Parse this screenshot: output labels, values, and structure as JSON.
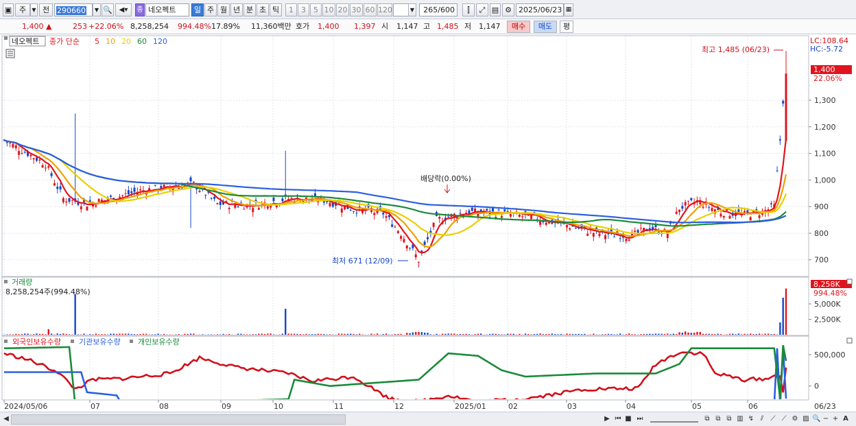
{
  "toolbar": {
    "market": "주",
    "prev": "전",
    "code": "290660",
    "name": "네오펙트",
    "name_tag": "종",
    "periods": [
      "일",
      "주",
      "월",
      "년",
      "분",
      "초",
      "틱"
    ],
    "active_period": "일",
    "ticks": [
      "1",
      "3",
      "5",
      "10",
      "20",
      "30",
      "60",
      "120"
    ],
    "count": "265",
    "count_max": "/600",
    "date": "2025/06/23"
  },
  "quote": {
    "price": "1,400",
    "change_arrow": "▲",
    "change": "253",
    "change_pct": "+22.06%",
    "volume": "8,258,254",
    "vol_ratio": "994.48%",
    "turnover": "17.89%",
    "amount": "11,360백만",
    "hoga_label": "호가",
    "ask": "1,400",
    "bid": "1,397",
    "open_label": "시",
    "open": "1,147",
    "high_label": "고",
    "high": "1,485",
    "low_label": "저",
    "low": "1,147",
    "buy": "매수",
    "sell": "매도",
    "eval": "평"
  },
  "legend": {
    "name": "네오펙트",
    "ma_label": "종가 단순",
    "ma": [
      {
        "label": "5",
        "color": "#e0141e"
      },
      {
        "label": "10",
        "color": "#f0a000"
      },
      {
        "label": "20",
        "color": "#e8d000"
      },
      {
        "label": "60",
        "color": "#1a8a3a"
      },
      {
        "label": "120",
        "color": "#2b5fe0"
      }
    ]
  },
  "annotations": {
    "high": "최고 1,485 (06/23)",
    "low": "최저 671 (12/09)",
    "dividend": "배당락(0.00%)",
    "lc": "LC:108.64",
    "hc": "HC:-5.72"
  },
  "price_axis": {
    "ticks": [
      "1,300",
      "1,200",
      "1,100",
      "1,000",
      "900",
      "800",
      "700"
    ],
    "current": "1,400",
    "current_pct": "22.06%"
  },
  "volume": {
    "title": "거래량",
    "value": "8,258,254주(994.48%)",
    "ticks": [
      "5,000K",
      "2,500K"
    ],
    "current": "8,258K",
    "current_pct": "994.48%"
  },
  "holdings": {
    "labels": [
      {
        "label": "외국인보유수량",
        "color": "#e0141e"
      },
      {
        "label": "기관보유수량",
        "color": "#2b5fe0"
      },
      {
        "label": "개인보유수량",
        "color": "#1a8a3a"
      }
    ],
    "ticks": [
      "500,000",
      "0"
    ]
  },
  "x_axis": {
    "labels": [
      "2024/05/06",
      "07",
      "08",
      "09",
      "10",
      "11",
      "12",
      "2025/01",
      "02",
      "03",
      "04",
      "05",
      "06"
    ],
    "current": "06/23"
  },
  "chart_data": {
    "type": "candlestick",
    "price_range": [
      640,
      1540
    ],
    "high": 1485,
    "low": 671,
    "close_last": 1400
  },
  "colors": {
    "up": "#e0141e",
    "down": "#1546c8",
    "accent": "#3b7bd6"
  }
}
